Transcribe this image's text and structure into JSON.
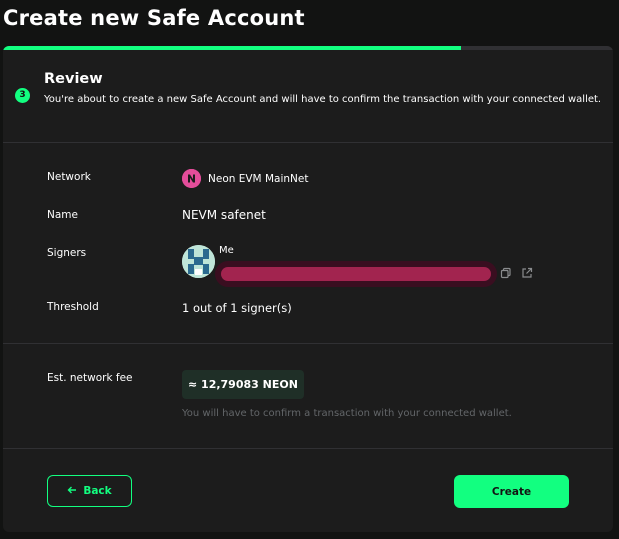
{
  "page": {
    "title": "Create new Safe Account"
  },
  "progress": {
    "fraction": 0.75,
    "color": "#12ff80"
  },
  "step": {
    "number": "3",
    "title": "Review",
    "description": "You're about to create a new Safe Account and will have to confirm the transaction with your connected wallet."
  },
  "details": {
    "network_label": "Network",
    "network_value": "Neon EVM MainNet",
    "name_label": "Name",
    "name_value": "NEVM safenet",
    "signers_label": "Signers",
    "signer_name": "Me",
    "threshold_label": "Threshold",
    "threshold_value": "1 out of 1 signer(s)"
  },
  "fee": {
    "label": "Est. network fee",
    "value": "≈ 12,79083 NEON",
    "note": "You will have to confirm a transaction with your connected wallet."
  },
  "actions": {
    "back_label": "Back",
    "create_label": "Create"
  },
  "icons": {
    "network": "neon-logo-icon",
    "avatar": "identicon-avatar",
    "copy": "copy-icon",
    "external": "external-link-icon",
    "back_arrow": "arrow-left-icon"
  },
  "colors": {
    "accent": "#12ff80",
    "background": "#121312",
    "card": "#1c1c1c",
    "redaction": "#a2244f"
  }
}
